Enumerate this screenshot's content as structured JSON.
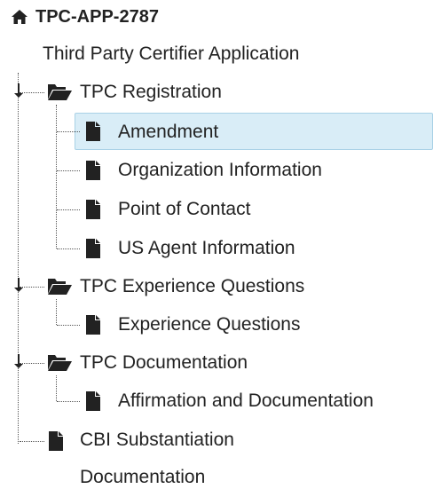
{
  "tree": {
    "root_id": "TPC-APP-2787",
    "root_subtitle": "Third Party Certifier Application",
    "folders": [
      {
        "label": "TPC Registration",
        "items": [
          "Amendment",
          "Organization Information",
          "Point of Contact",
          "US Agent Information"
        ]
      },
      {
        "label": "TPC Experience Questions",
        "items": [
          "Experience Questions"
        ]
      },
      {
        "label": "TPC Documentation",
        "items": [
          "Affirmation and Documentation"
        ]
      }
    ],
    "last_item": {
      "label_line1": "CBI Substantiation",
      "label_line2": "Documentation"
    },
    "selected_item": "Amendment"
  },
  "colors": {
    "selected_bg": "#d9edf7",
    "selected_border": "#a9d1e6",
    "text": "#222222"
  },
  "icons": {
    "root": "home-icon",
    "folder": "folder-open-icon",
    "file": "file-icon"
  }
}
